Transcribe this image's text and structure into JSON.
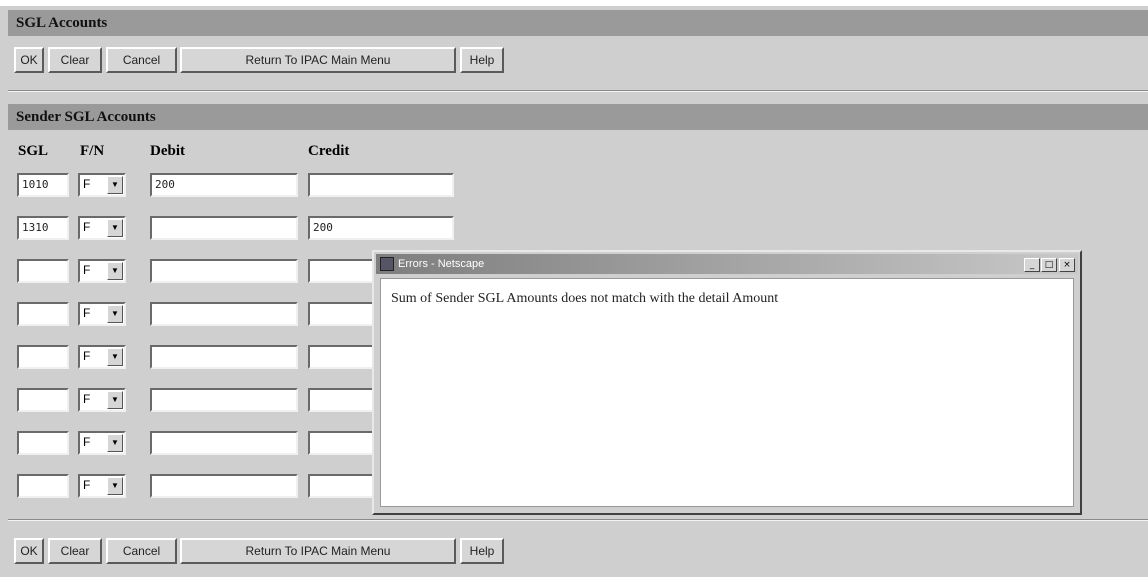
{
  "section1": {
    "title": "SGL Accounts"
  },
  "toolbar": {
    "ok": "OK",
    "clear": "Clear",
    "cancel": "Cancel",
    "return": "Return To IPAC Main Menu",
    "help": "Help"
  },
  "section2": {
    "title": "Sender SGL Accounts"
  },
  "columns": {
    "sgl": "SGL",
    "fn": "F/N",
    "debit": "Debit",
    "credit": "Credit"
  },
  "rows": [
    {
      "sgl": "1010",
      "fn": "F",
      "debit": "200",
      "credit": ""
    },
    {
      "sgl": "1310",
      "fn": "F",
      "debit": "",
      "credit": "200"
    },
    {
      "sgl": "",
      "fn": "F",
      "debit": "",
      "credit": ""
    },
    {
      "sgl": "",
      "fn": "F",
      "debit": "",
      "credit": ""
    },
    {
      "sgl": "",
      "fn": "F",
      "debit": "",
      "credit": ""
    },
    {
      "sgl": "",
      "fn": "F",
      "debit": "",
      "credit": ""
    },
    {
      "sgl": "",
      "fn": "F",
      "debit": "",
      "credit": ""
    },
    {
      "sgl": "",
      "fn": "F",
      "debit": "",
      "credit": ""
    }
  ],
  "dialog": {
    "title": "Errors - Netscape",
    "message": "Sum of Sender SGL Amounts does not match with the detail Amount",
    "minimize": "_",
    "maximize": "□",
    "close": "×"
  }
}
